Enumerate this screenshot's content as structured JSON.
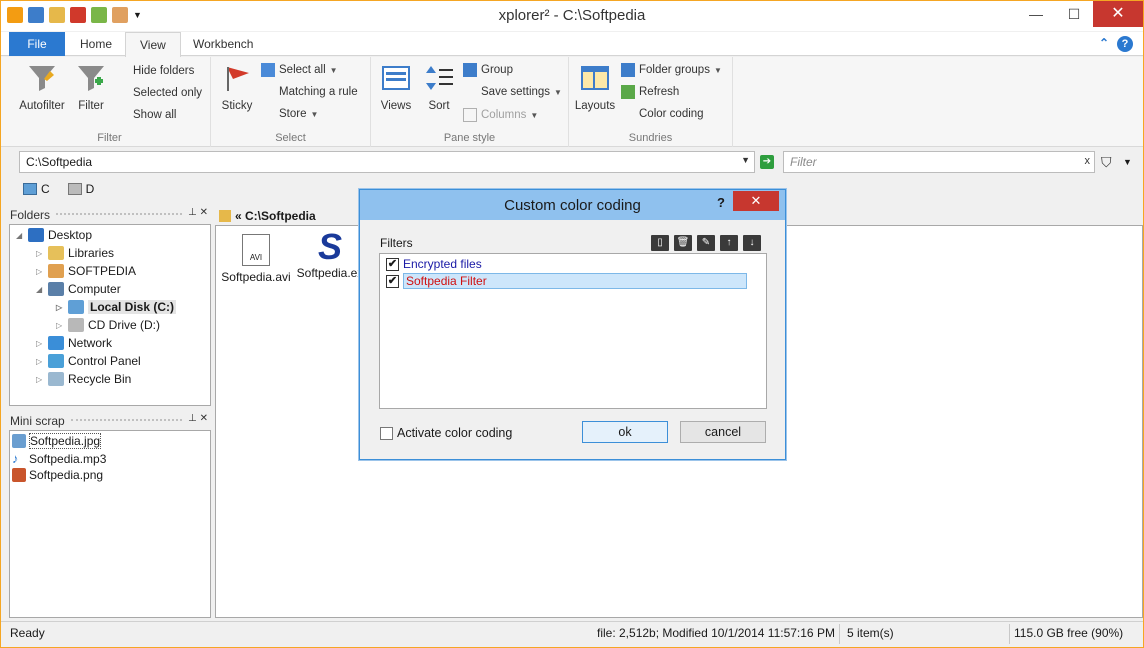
{
  "window": {
    "title": "xplorer² - C:\\Softpedia",
    "controls": {
      "minimize": "—",
      "maximize": "☐",
      "close": "✕"
    }
  },
  "ribbon": {
    "tabs": [
      "File",
      "Home",
      "View",
      "Workbench"
    ],
    "active_tab": "View",
    "help_icons": [
      "⌃",
      "?"
    ],
    "groups": {
      "filter": {
        "label": "Filter",
        "autofilter": "Autofilter",
        "filter": "Filter",
        "hide_folders": "Hide folders",
        "selected_only": "Selected only",
        "show_all": "Show all"
      },
      "select": {
        "label": "Select",
        "sticky": "Sticky",
        "select_all": "Select all",
        "matching_a_rule": "Matching a rule",
        "store": "Store"
      },
      "pane_style": {
        "label": "Pane style",
        "views": "Views",
        "sort": "Sort",
        "group": "Group",
        "save_settings": "Save settings",
        "columns": "Columns"
      },
      "sundries": {
        "label": "Sundries",
        "layouts": "Layouts",
        "folder_groups": "Folder groups",
        "refresh": "Refresh",
        "color_coding": "Color coding"
      }
    }
  },
  "address": {
    "path": "C:\\Softpedia",
    "filter_placeholder": "Filter",
    "filter_clear": "x"
  },
  "drives": [
    "C",
    "D"
  ],
  "folders_pane": {
    "title": "Folders",
    "items": [
      {
        "label": "Desktop"
      },
      {
        "label": "Libraries"
      },
      {
        "label": "SOFTPEDIA"
      },
      {
        "label": "Computer"
      },
      {
        "label": "Local Disk (C:)"
      },
      {
        "label": "CD Drive (D:)"
      },
      {
        "label": "Network"
      },
      {
        "label": "Control Panel"
      },
      {
        "label": "Recycle Bin"
      }
    ]
  },
  "mini_scrap": {
    "title": "Mini scrap",
    "items": [
      "Softpedia.jpg",
      "Softpedia.mp3",
      "Softpedia.png"
    ]
  },
  "main_pane": {
    "breadcrumb": "« C:\\Softpedia",
    "files": [
      {
        "name": "Softpedia.avi",
        "badge": "AVI"
      },
      {
        "name": "Softpedia.ex",
        "badge": "S"
      }
    ]
  },
  "status": {
    "ready": "Ready",
    "file_info": "file: 2,512b; Modified 10/1/2014 11:57:16 PM",
    "items": "5 item(s)",
    "free": "115.0 GB free (90%)"
  },
  "dialog": {
    "title": "Custom color coding",
    "help": "?",
    "close": "✕",
    "filters_label": "Filters",
    "toolbar": [
      "▯",
      "🗑",
      "✎",
      "↑",
      "↓"
    ],
    "filters": [
      {
        "label": "Encrypted files",
        "checked": "✔",
        "color": "#1a1aa6"
      },
      {
        "label": "Softpedia Filter",
        "checked": "✔",
        "color": "#d01010"
      }
    ],
    "activate_label": "Activate color coding",
    "ok": "ok",
    "cancel": "cancel"
  }
}
